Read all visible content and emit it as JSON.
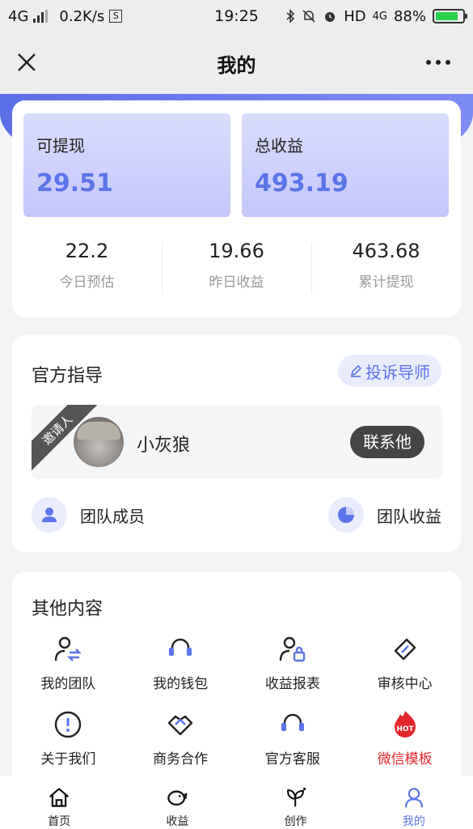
{
  "status_bar": {
    "network": "4G",
    "speed": "0.2K/s",
    "time": "19:25",
    "hd": "HD",
    "net_right": "4G",
    "battery": "88%"
  },
  "nav": {
    "title": "我的"
  },
  "earnings": {
    "withdrawable_label": "可提现",
    "withdrawable_value": "29.51",
    "total_label": "总收益",
    "total_value": "493.19",
    "stats": [
      {
        "value": "22.2",
        "label": "今日预估"
      },
      {
        "value": "19.66",
        "label": "昨日收益"
      },
      {
        "value": "463.68",
        "label": "累计提现"
      }
    ]
  },
  "guide": {
    "title": "官方指导",
    "complain_label": "投诉导师",
    "inviter_ribbon": "邀请人",
    "inviter_name": "小灰狼",
    "contact_label": "联系他",
    "team_members": "团队成员",
    "team_earnings": "团队收益"
  },
  "other": {
    "title": "其他内容",
    "items": [
      {
        "label": "我的团队",
        "icon": "team-icon"
      },
      {
        "label": "我的钱包",
        "icon": "wallet-icon"
      },
      {
        "label": "收益报表",
        "icon": "report-icon"
      },
      {
        "label": "审核中心",
        "icon": "review-icon"
      },
      {
        "label": "关于我们",
        "icon": "info-icon"
      },
      {
        "label": "商务合作",
        "icon": "handshake-icon"
      },
      {
        "label": "官方客服",
        "icon": "headset-icon"
      },
      {
        "label": "微信模板",
        "icon": "hot-icon",
        "badge": "HOT"
      }
    ]
  },
  "tabs": [
    {
      "label": "首页",
      "icon": "home-icon"
    },
    {
      "label": "收益",
      "icon": "piggy-icon"
    },
    {
      "label": "创作",
      "icon": "sprout-icon"
    },
    {
      "label": "我的",
      "icon": "user-icon"
    }
  ],
  "colors": {
    "accent": "#5b74e8",
    "hot": "#e3262d"
  }
}
